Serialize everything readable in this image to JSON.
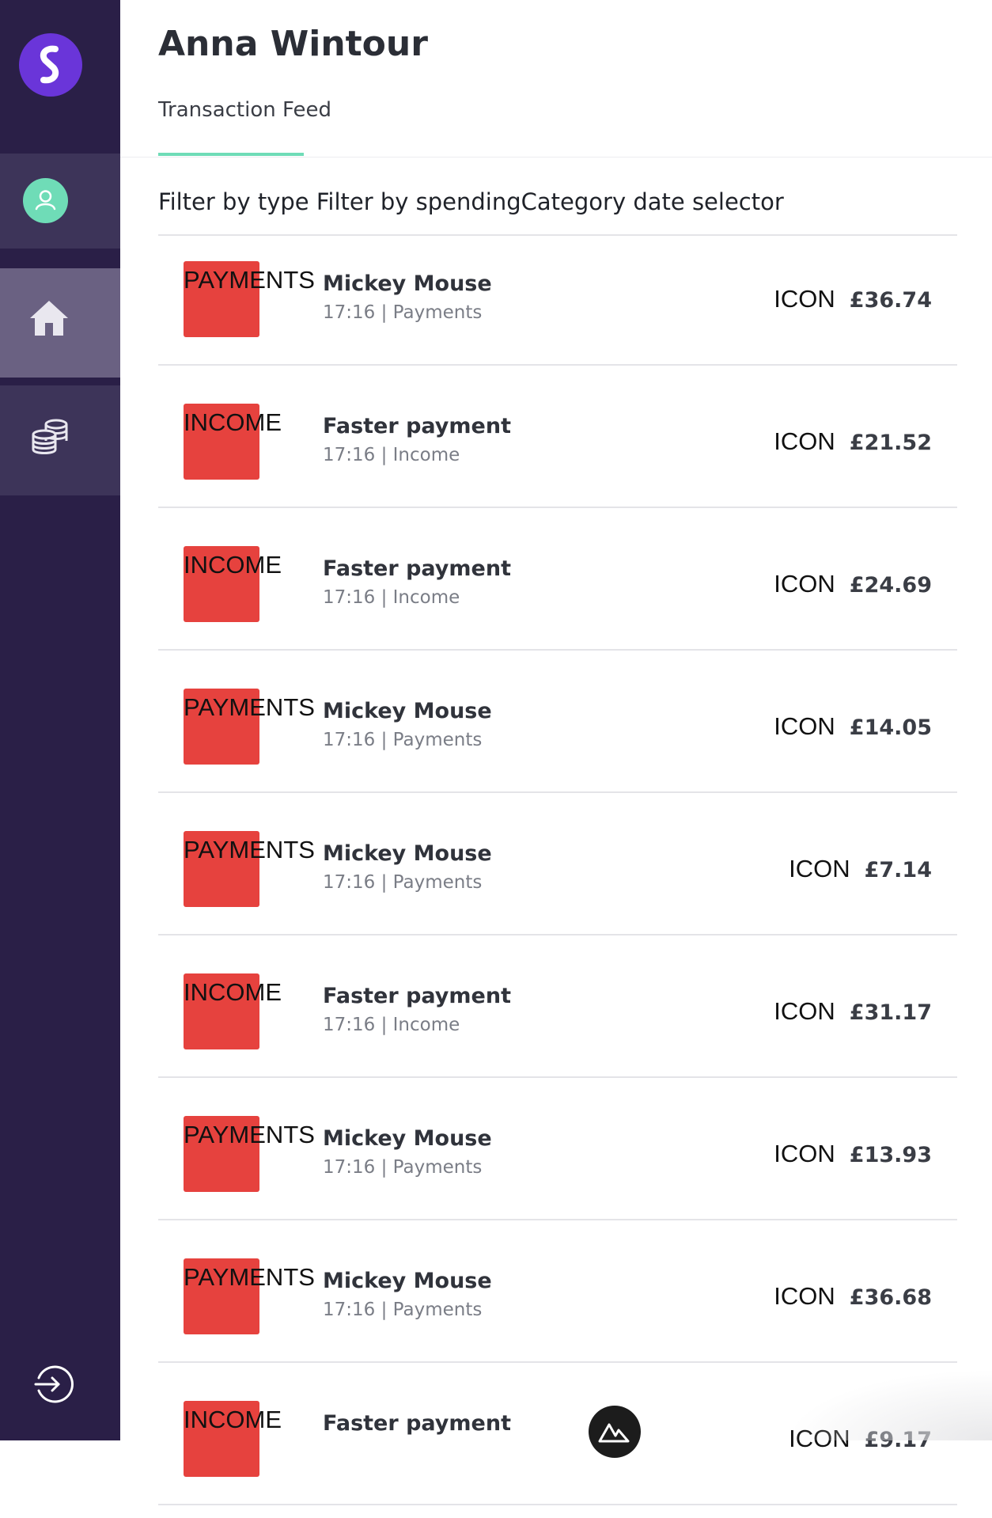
{
  "user": {
    "name": "Anna Wintour"
  },
  "tabs": [
    {
      "label": "Transaction Feed"
    }
  ],
  "filters": {
    "text": "Filter by type Filter by spendingCategory date selector"
  },
  "transactions": [
    {
      "type": "PAYMENTS",
      "name": "Mickey Mouse",
      "meta": "17:16 | Payments",
      "icon_label": "ICON",
      "amount": "£36.74"
    },
    {
      "type": "INCOME",
      "name": "Faster payment",
      "meta": "17:16 | Income",
      "icon_label": "ICON",
      "amount": "£21.52"
    },
    {
      "type": "INCOME",
      "name": "Faster payment",
      "meta": "17:16 | Income",
      "icon_label": "ICON",
      "amount": "£24.69"
    },
    {
      "type": "PAYMENTS",
      "name": "Mickey Mouse",
      "meta": "17:16 | Payments",
      "icon_label": "ICON",
      "amount": "£14.05"
    },
    {
      "type": "PAYMENTS",
      "name": "Mickey Mouse",
      "meta": "17:16 | Payments",
      "icon_label": "ICON",
      "amount": "£7.14"
    },
    {
      "type": "INCOME",
      "name": "Faster payment",
      "meta": "17:16 | Income",
      "icon_label": "ICON",
      "amount": "£31.17"
    },
    {
      "type": "PAYMENTS",
      "name": "Mickey Mouse",
      "meta": "17:16 | Payments",
      "icon_label": "ICON",
      "amount": "£13.93"
    },
    {
      "type": "PAYMENTS",
      "name": "Mickey Mouse",
      "meta": "17:16 | Payments",
      "icon_label": "ICON",
      "amount": "£36.68"
    },
    {
      "type": "INCOME",
      "name": "Faster payment",
      "meta": "",
      "icon_label": "ICON",
      "amount": "£9.17"
    }
  ],
  "sidebar": {
    "icons": [
      "logo-icon",
      "user-icon",
      "home-icon",
      "coins-icon",
      "logout-icon"
    ]
  },
  "colors": {
    "sidebar": "#2a1f47",
    "accent": "#6fdcb7",
    "logo": "#6a35d9",
    "tx_icon": "#e6423e"
  }
}
